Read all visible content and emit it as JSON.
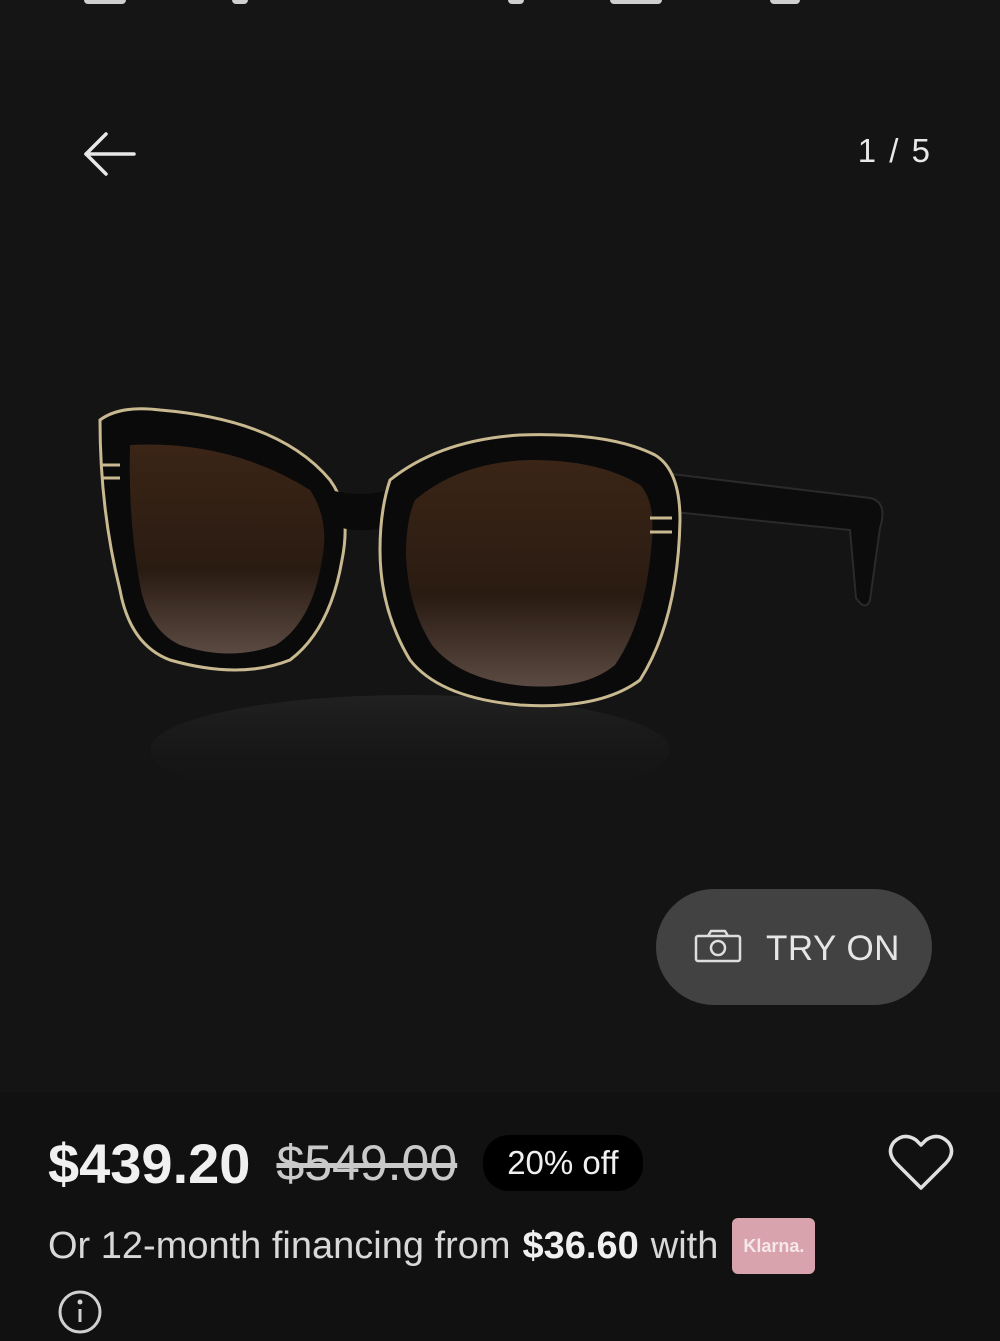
{
  "gallery": {
    "counter": "1 / 5",
    "back_icon": "arrow-left-icon",
    "image": "tiffany-sunglasses-black-gold-brown-gradient"
  },
  "try_on": {
    "label": "TRY ON",
    "icon": "camera-icon"
  },
  "pricing": {
    "current": "$439.20",
    "original": "$549.00",
    "discount": "20% off",
    "wishlist_icon": "heart-icon"
  },
  "financing": {
    "prefix": "Or 12-month financing from",
    "amount": "$36.60",
    "suffix": "with",
    "provider": "Klarna.",
    "info_icon": "info-icon"
  },
  "colors": {
    "background": "#111111",
    "button": "#424242",
    "badge": "#000000",
    "klarna": "#d9a3ad"
  }
}
